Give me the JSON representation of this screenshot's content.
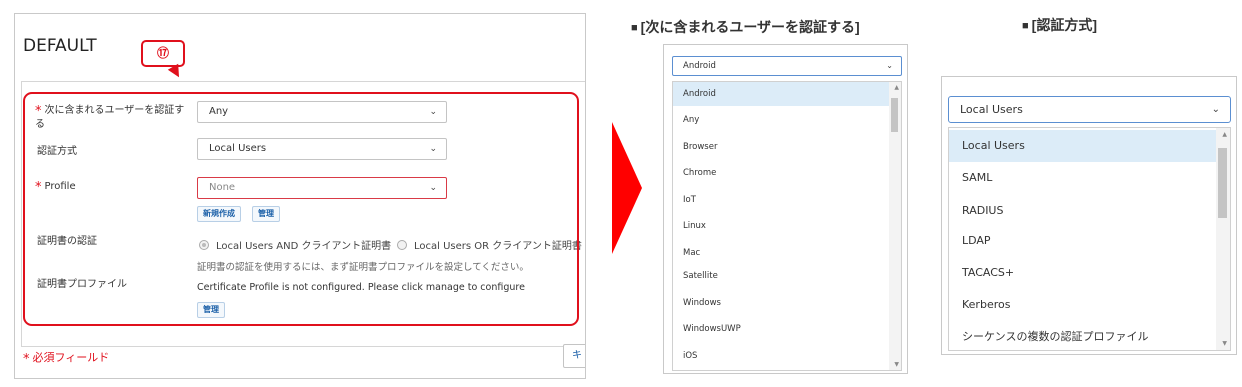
{
  "dialog": {
    "title": "DEFAULT",
    "callout": "⑰",
    "fields": {
      "include_users_label": "次に含まれるユーザーを認証する",
      "include_users_value": "Any",
      "auth_method_label": "認証方式",
      "auth_method_value": "Local Users",
      "profile_label": "Profile",
      "profile_value": "None",
      "new_button": "新規作成",
      "manage_button": "管理",
      "cert_auth_label": "証明書の認証",
      "radio_and": "Local Users AND クライアント証明書",
      "radio_or": "Local Users OR クライアント証明書",
      "cert_hint": "証明書の認証を使用するには、まず証明書プロファイルを設定してください。",
      "cert_profile_label": "証明書プロファイル",
      "cert_profile_text": "Certificate Profile is not configured. Please click manage to configure",
      "cert_manage_button": "管理"
    },
    "required_note": "必須フィールド",
    "footer_button": "キ"
  },
  "colors": {
    "accent_red": "#e0101c",
    "link_blue": "#1a5fa8",
    "selected_bg": "#dcecf8"
  },
  "panel1": {
    "heading": "[次に含まれるユーザーを認証する]",
    "selected": "Android",
    "options": [
      "Android",
      "Any",
      "Browser",
      "Chrome",
      "IoT",
      "Linux",
      "Mac",
      "Satellite",
      "Windows",
      "WindowsUWP",
      "iOS"
    ]
  },
  "panel2": {
    "heading": "[認証方式]",
    "selected": "Local Users",
    "options": [
      "Local Users",
      "SAML",
      "RADIUS",
      "LDAP",
      "TACACS+",
      "Kerberos",
      "シーケンスの複数の認証プロファイル"
    ]
  }
}
